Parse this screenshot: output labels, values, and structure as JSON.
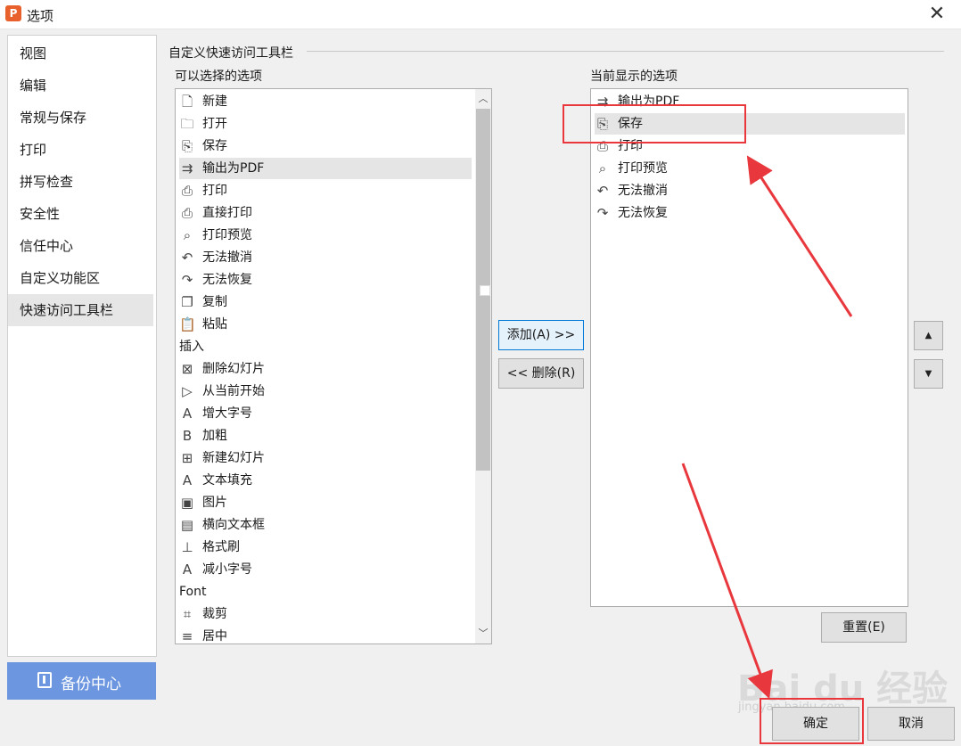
{
  "window": {
    "title": "选项",
    "app_icon_letter": "P"
  },
  "nav": {
    "items": [
      {
        "label": "视图"
      },
      {
        "label": "编辑"
      },
      {
        "label": "常规与保存"
      },
      {
        "label": "打印"
      },
      {
        "label": "拼写检查"
      },
      {
        "label": "安全性"
      },
      {
        "label": "信任中心"
      },
      {
        "label": "自定义功能区"
      },
      {
        "label": "快速访问工具栏",
        "active": true
      }
    ],
    "backup_label": "备份中心"
  },
  "section_title": "自定义快速访问工具栏",
  "available": {
    "label": "可以选择的选项",
    "items": [
      {
        "label": "新建",
        "icon": "new-doc-icon"
      },
      {
        "label": "打开",
        "icon": "folder-icon"
      },
      {
        "label": "保存",
        "icon": "save-icon"
      },
      {
        "label": "输出为PDF",
        "icon": "pdf-export-icon",
        "selected": true
      },
      {
        "label": "打印",
        "icon": "printer-icon"
      },
      {
        "label": "直接打印",
        "icon": "direct-print-icon"
      },
      {
        "label": "打印预览",
        "icon": "print-preview-icon"
      },
      {
        "label": "无法撤消",
        "icon": "undo-icon"
      },
      {
        "label": "无法恢复",
        "icon": "redo-icon"
      },
      {
        "label": "复制",
        "icon": "copy-icon"
      },
      {
        "label": "粘贴",
        "icon": "paste-icon"
      },
      {
        "label": "插入",
        "icon": "",
        "category": true
      },
      {
        "label": "删除幻灯片",
        "icon": "delete-slide-icon"
      },
      {
        "label": "从当前开始",
        "icon": "play-icon"
      },
      {
        "label": "增大字号",
        "icon": "font-increase-icon"
      },
      {
        "label": "加粗",
        "icon": "bold-icon"
      },
      {
        "label": "新建幻灯片",
        "icon": "new-slide-icon"
      },
      {
        "label": "文本填充",
        "icon": "text-fill-icon"
      },
      {
        "label": "图片",
        "icon": "picture-icon"
      },
      {
        "label": "横向文本框",
        "icon": "textbox-icon"
      },
      {
        "label": "格式刷",
        "icon": "format-painter-icon"
      },
      {
        "label": "减小字号",
        "icon": "font-decrease-icon"
      },
      {
        "label": "Font",
        "icon": "",
        "category": true
      },
      {
        "label": "裁剪",
        "icon": "crop-icon"
      },
      {
        "label": "居中",
        "icon": "align-center-icon"
      }
    ]
  },
  "current": {
    "label": "当前显示的选项",
    "items": [
      {
        "label": "输出为PDF",
        "icon": "pdf-export-icon"
      },
      {
        "label": "保存",
        "icon": "save-icon",
        "selected": true
      },
      {
        "label": "打印",
        "icon": "printer-icon"
      },
      {
        "label": "打印预览",
        "icon": "print-preview-icon"
      },
      {
        "label": "无法撤消",
        "icon": "undo-icon"
      },
      {
        "label": "无法恢复",
        "icon": "redo-icon"
      }
    ]
  },
  "buttons": {
    "add": "添加(A) >>",
    "remove": "<< 删除(R)",
    "reset": "重置(E)",
    "ok": "确定",
    "cancel": "取消"
  },
  "watermark": {
    "text": "Bai du 经验",
    "sub": "jingyan.baidu.com"
  },
  "colors": {
    "accent": "#6c96e0",
    "annotation": "#e8383d",
    "selection": "#e5e5e5"
  }
}
